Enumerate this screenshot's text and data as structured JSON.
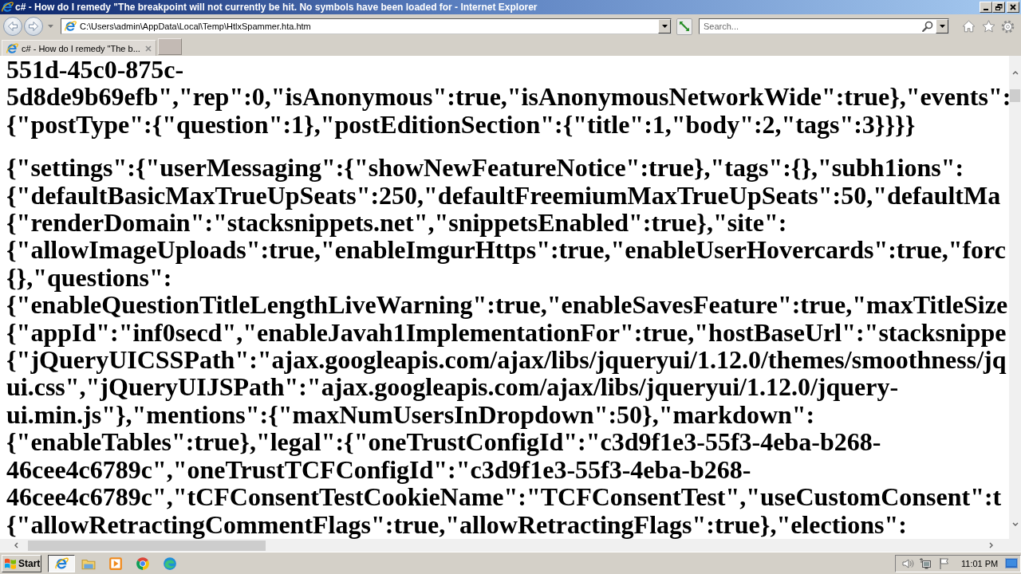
{
  "window": {
    "title": "c# - How do I remedy \"The breakpoint will not currently be hit. No symbols have been loaded for - Internet Explorer"
  },
  "address_bar": {
    "value": "C:\\Users\\admin\\AppData\\Local\\Temp\\HtlxSpammer.hta.htm"
  },
  "search": {
    "placeholder": "Search..."
  },
  "tabs": [
    {
      "label": "c# - How do I remedy \"The b...",
      "selected": true
    }
  ],
  "document": {
    "paragraphs": [
      {
        "lines": [
          "551d-45c0-875c-",
          "5d8de9b69efb\",\"rep\":0,\"isAnonymous\":true,\"isAnonymousNetworkWide\":true},\"events\":",
          "{\"postType\":{\"question\":1},\"postEditionSection\":{\"title\":1,\"body\":2,\"tags\":3}}}}"
        ]
      },
      {
        "lines": [
          "{\"settings\":{\"userMessaging\":{\"showNewFeatureNotice\":true},\"tags\":{},\"subh1ions\":",
          "{\"defaultBasicMaxTrueUpSeats\":250,\"defaultFreemiumMaxTrueUpSeats\":50,\"defaultMa",
          "{\"renderDomain\":\"stacksnippets.net\",\"snippetsEnabled\":true},\"site\":",
          "{\"allowImageUploads\":true,\"enableImgurHttps\":true,\"enableUserHovercards\":true,\"forc",
          "{},\"questions\":",
          "{\"enableQuestionTitleLengthLiveWarning\":true,\"enableSavesFeature\":true,\"maxTitleSize",
          "{\"appId\":\"inf0secd\",\"enableJavah1ImplementationFor\":true,\"hostBaseUrl\":\"stacksnippe",
          "{\"jQueryUICSSPath\":\"ajax.googleapis.com/ajax/libs/jqueryui/1.12.0/themes/smoothness/jq",
          "ui.css\",\"jQueryUIJSPath\":\"ajax.googleapis.com/ajax/libs/jqueryui/1.12.0/jquery-",
          "ui.min.js\"},\"mentions\":{\"maxNumUsersInDropdown\":50},\"markdown\":",
          "{\"enableTables\":true},\"legal\":{\"oneTrustConfigId\":\"c3d9f1e3-55f3-4eba-b268-",
          "46cee4c6789c\",\"oneTrustTCFConfigId\":\"c3d9f1e3-55f3-4eba-b268-",
          "46cee4c6789c\",\"tCFConsentTestCookieName\":\"TCFConsentTest\",\"useCustomConsent\":t",
          "{\"allowRetractingCommentFlags\":true,\"allowRetractingFlags\":true},\"elections\":"
        ]
      }
    ]
  },
  "taskbar": {
    "start": "Start",
    "apps": [
      {
        "kind": "ie",
        "selected": true
      },
      {
        "kind": "folder",
        "selected": false
      },
      {
        "kind": "media",
        "selected": false
      },
      {
        "kind": "chrome",
        "selected": false
      },
      {
        "kind": "edge",
        "selected": false
      }
    ],
    "clock": "11:01 PM"
  }
}
